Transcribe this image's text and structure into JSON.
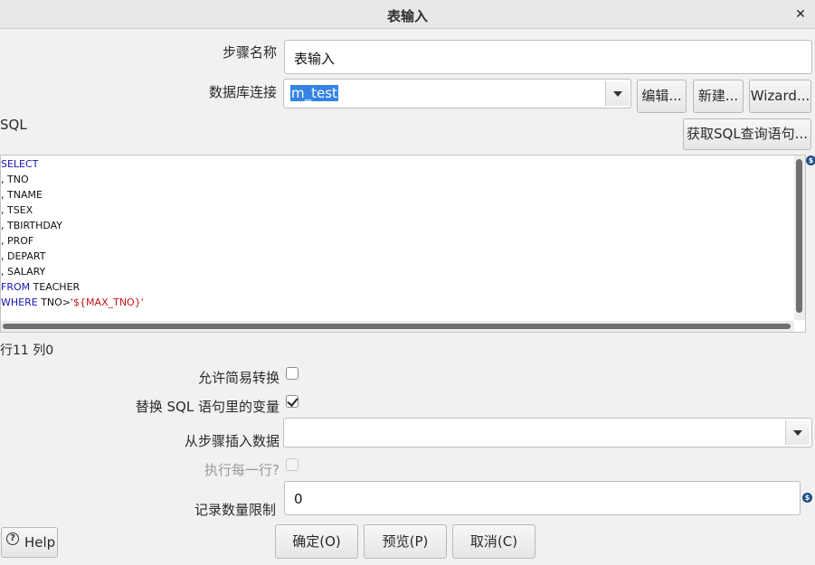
{
  "window": {
    "title": "表输入",
    "close_glyph": "✕"
  },
  "step_name": {
    "label": "步骤名称",
    "value": "表输入"
  },
  "db_connection": {
    "label": "数据库连接",
    "value": "m_test",
    "edit_label": "编辑...",
    "new_label": "新建...",
    "wizard_label": "Wizard..."
  },
  "sql": {
    "label": "SQL",
    "get_sql_label": "获取SQL查询语句...",
    "lines": [
      {
        "kw": "SELECT",
        "text": ""
      },
      {
        "kw": "",
        "text": ", TNO"
      },
      {
        "kw": "",
        "text": ", TNAME"
      },
      {
        "kw": "",
        "text": ", TSEX"
      },
      {
        "kw": "",
        "text": ", TBIRTHDAY"
      },
      {
        "kw": "",
        "text": ", PROF"
      },
      {
        "kw": "",
        "text": ", DEPART"
      },
      {
        "kw": "",
        "text": ", SALARY"
      },
      {
        "kw": "FROM",
        "text": " TEACHER"
      },
      {
        "kw": "WHERE",
        "text": " TNO>",
        "str": "'${MAX_TNO}'"
      }
    ],
    "cursor_status": "行11 列0",
    "var_icon": "$"
  },
  "options": {
    "lazy_conversion": {
      "label": "允许简易转换",
      "checked": false
    },
    "replace_vars": {
      "label": "替换 SQL 语句里的变量",
      "checked": true
    },
    "insert_from_step": {
      "label": "从步骤插入数据",
      "value": ""
    },
    "execute_each_row": {
      "label": "执行每一行?",
      "checked": false,
      "disabled": true
    },
    "limit": {
      "label": "记录数量限制",
      "value": "0"
    }
  },
  "buttons": {
    "help": "Help",
    "ok": "确定(O)",
    "preview": "预览(P)",
    "cancel": "取消(C)"
  },
  "icons": {
    "help": "?",
    "variable": "$"
  }
}
